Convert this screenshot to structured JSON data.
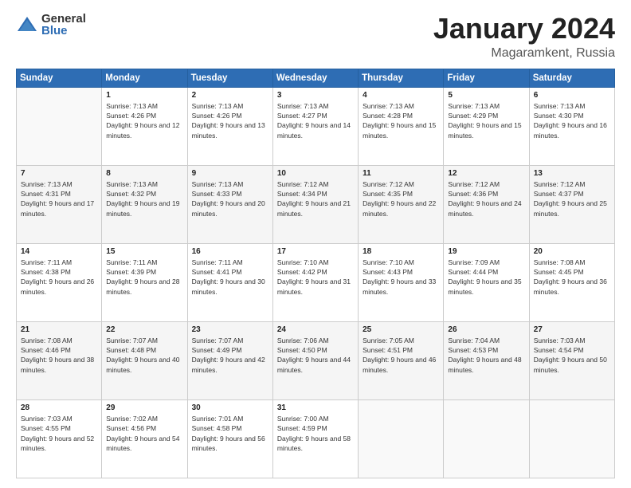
{
  "logo": {
    "general": "General",
    "blue": "Blue"
  },
  "title": {
    "month": "January 2024",
    "location": "Magaramkent, Russia"
  },
  "weekdays": [
    "Sunday",
    "Monday",
    "Tuesday",
    "Wednesday",
    "Thursday",
    "Friday",
    "Saturday"
  ],
  "weeks": [
    [
      {
        "day": "",
        "sunrise": "",
        "sunset": "",
        "daylight": ""
      },
      {
        "day": "1",
        "sunrise": "Sunrise: 7:13 AM",
        "sunset": "Sunset: 4:26 PM",
        "daylight": "Daylight: 9 hours and 12 minutes."
      },
      {
        "day": "2",
        "sunrise": "Sunrise: 7:13 AM",
        "sunset": "Sunset: 4:26 PM",
        "daylight": "Daylight: 9 hours and 13 minutes."
      },
      {
        "day": "3",
        "sunrise": "Sunrise: 7:13 AM",
        "sunset": "Sunset: 4:27 PM",
        "daylight": "Daylight: 9 hours and 14 minutes."
      },
      {
        "day": "4",
        "sunrise": "Sunrise: 7:13 AM",
        "sunset": "Sunset: 4:28 PM",
        "daylight": "Daylight: 9 hours and 15 minutes."
      },
      {
        "day": "5",
        "sunrise": "Sunrise: 7:13 AM",
        "sunset": "Sunset: 4:29 PM",
        "daylight": "Daylight: 9 hours and 15 minutes."
      },
      {
        "day": "6",
        "sunrise": "Sunrise: 7:13 AM",
        "sunset": "Sunset: 4:30 PM",
        "daylight": "Daylight: 9 hours and 16 minutes."
      }
    ],
    [
      {
        "day": "7",
        "sunrise": "Sunrise: 7:13 AM",
        "sunset": "Sunset: 4:31 PM",
        "daylight": "Daylight: 9 hours and 17 minutes."
      },
      {
        "day": "8",
        "sunrise": "Sunrise: 7:13 AM",
        "sunset": "Sunset: 4:32 PM",
        "daylight": "Daylight: 9 hours and 19 minutes."
      },
      {
        "day": "9",
        "sunrise": "Sunrise: 7:13 AM",
        "sunset": "Sunset: 4:33 PM",
        "daylight": "Daylight: 9 hours and 20 minutes."
      },
      {
        "day": "10",
        "sunrise": "Sunrise: 7:12 AM",
        "sunset": "Sunset: 4:34 PM",
        "daylight": "Daylight: 9 hours and 21 minutes."
      },
      {
        "day": "11",
        "sunrise": "Sunrise: 7:12 AM",
        "sunset": "Sunset: 4:35 PM",
        "daylight": "Daylight: 9 hours and 22 minutes."
      },
      {
        "day": "12",
        "sunrise": "Sunrise: 7:12 AM",
        "sunset": "Sunset: 4:36 PM",
        "daylight": "Daylight: 9 hours and 24 minutes."
      },
      {
        "day": "13",
        "sunrise": "Sunrise: 7:12 AM",
        "sunset": "Sunset: 4:37 PM",
        "daylight": "Daylight: 9 hours and 25 minutes."
      }
    ],
    [
      {
        "day": "14",
        "sunrise": "Sunrise: 7:11 AM",
        "sunset": "Sunset: 4:38 PM",
        "daylight": "Daylight: 9 hours and 26 minutes."
      },
      {
        "day": "15",
        "sunrise": "Sunrise: 7:11 AM",
        "sunset": "Sunset: 4:39 PM",
        "daylight": "Daylight: 9 hours and 28 minutes."
      },
      {
        "day": "16",
        "sunrise": "Sunrise: 7:11 AM",
        "sunset": "Sunset: 4:41 PM",
        "daylight": "Daylight: 9 hours and 30 minutes."
      },
      {
        "day": "17",
        "sunrise": "Sunrise: 7:10 AM",
        "sunset": "Sunset: 4:42 PM",
        "daylight": "Daylight: 9 hours and 31 minutes."
      },
      {
        "day": "18",
        "sunrise": "Sunrise: 7:10 AM",
        "sunset": "Sunset: 4:43 PM",
        "daylight": "Daylight: 9 hours and 33 minutes."
      },
      {
        "day": "19",
        "sunrise": "Sunrise: 7:09 AM",
        "sunset": "Sunset: 4:44 PM",
        "daylight": "Daylight: 9 hours and 35 minutes."
      },
      {
        "day": "20",
        "sunrise": "Sunrise: 7:08 AM",
        "sunset": "Sunset: 4:45 PM",
        "daylight": "Daylight: 9 hours and 36 minutes."
      }
    ],
    [
      {
        "day": "21",
        "sunrise": "Sunrise: 7:08 AM",
        "sunset": "Sunset: 4:46 PM",
        "daylight": "Daylight: 9 hours and 38 minutes."
      },
      {
        "day": "22",
        "sunrise": "Sunrise: 7:07 AM",
        "sunset": "Sunset: 4:48 PM",
        "daylight": "Daylight: 9 hours and 40 minutes."
      },
      {
        "day": "23",
        "sunrise": "Sunrise: 7:07 AM",
        "sunset": "Sunset: 4:49 PM",
        "daylight": "Daylight: 9 hours and 42 minutes."
      },
      {
        "day": "24",
        "sunrise": "Sunrise: 7:06 AM",
        "sunset": "Sunset: 4:50 PM",
        "daylight": "Daylight: 9 hours and 44 minutes."
      },
      {
        "day": "25",
        "sunrise": "Sunrise: 7:05 AM",
        "sunset": "Sunset: 4:51 PM",
        "daylight": "Daylight: 9 hours and 46 minutes."
      },
      {
        "day": "26",
        "sunrise": "Sunrise: 7:04 AM",
        "sunset": "Sunset: 4:53 PM",
        "daylight": "Daylight: 9 hours and 48 minutes."
      },
      {
        "day": "27",
        "sunrise": "Sunrise: 7:03 AM",
        "sunset": "Sunset: 4:54 PM",
        "daylight": "Daylight: 9 hours and 50 minutes."
      }
    ],
    [
      {
        "day": "28",
        "sunrise": "Sunrise: 7:03 AM",
        "sunset": "Sunset: 4:55 PM",
        "daylight": "Daylight: 9 hours and 52 minutes."
      },
      {
        "day": "29",
        "sunrise": "Sunrise: 7:02 AM",
        "sunset": "Sunset: 4:56 PM",
        "daylight": "Daylight: 9 hours and 54 minutes."
      },
      {
        "day": "30",
        "sunrise": "Sunrise: 7:01 AM",
        "sunset": "Sunset: 4:58 PM",
        "daylight": "Daylight: 9 hours and 56 minutes."
      },
      {
        "day": "31",
        "sunrise": "Sunrise: 7:00 AM",
        "sunset": "Sunset: 4:59 PM",
        "daylight": "Daylight: 9 hours and 58 minutes."
      },
      {
        "day": "",
        "sunrise": "",
        "sunset": "",
        "daylight": ""
      },
      {
        "day": "",
        "sunrise": "",
        "sunset": "",
        "daylight": ""
      },
      {
        "day": "",
        "sunrise": "",
        "sunset": "",
        "daylight": ""
      }
    ]
  ]
}
